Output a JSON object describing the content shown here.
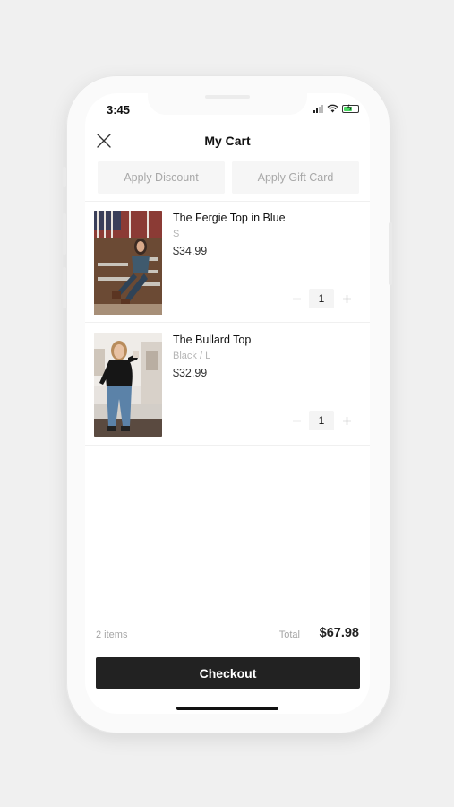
{
  "status_bar": {
    "time": "3:45",
    "signal_icon": "cellular-signal-icon",
    "wifi_icon": "wifi-icon",
    "battery_icon": "battery-charging-icon"
  },
  "header": {
    "title": "My Cart",
    "close_icon": "close-icon"
  },
  "actions": {
    "discount_label": "Apply Discount",
    "gift_card_label": "Apply Gift Card"
  },
  "cart": {
    "items": [
      {
        "name": "The Fergie Top in Blue",
        "variant": "S",
        "price": "$34.99",
        "quantity": "1",
        "decrease_icon": "minus-icon",
        "increase_icon": "plus-icon"
      },
      {
        "name": "The Bullard Top",
        "variant": "Black / L",
        "price": "$32.99",
        "quantity": "1",
        "decrease_icon": "minus-icon",
        "increase_icon": "plus-icon"
      }
    ]
  },
  "summary": {
    "item_count": "2 items",
    "total_label": "Total",
    "total_value": "$67.98"
  },
  "checkout": {
    "label": "Checkout"
  },
  "colors": {
    "checkout_bg": "#222222",
    "battery": "#4cd964",
    "muted_text": "#a8a8a8"
  }
}
